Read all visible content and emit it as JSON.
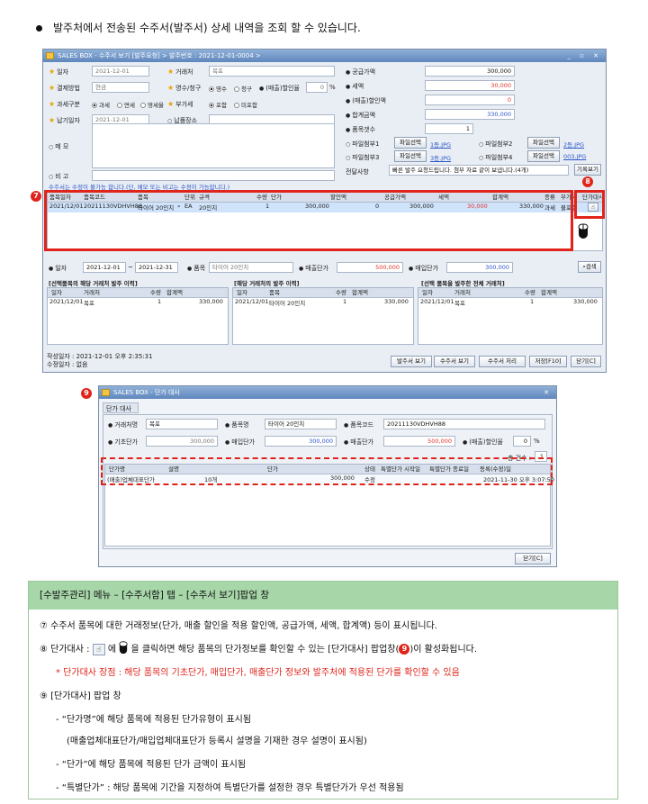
{
  "intro": "발주처에서 전송된 수주서(발주서) 상세 내역을 조회 할 수 있습니다.",
  "window1": {
    "title": "SALES BOX - 수주서 보기 [발주요청] > 발주번호 : 2021-12-01-0004 >",
    "form": {
      "date_label": "일자",
      "date_value": "2021-12-01",
      "partner_label": "거래처",
      "partner_value": "목포",
      "pay_label": "결제방법",
      "pay_value": "현금",
      "receipt_label": "영수/청구",
      "receipt_opt1": "영수",
      "receipt_opt2": "청구",
      "discount_rate_label": "(매출)할인율",
      "discount_rate_value": "0",
      "discount_rate_unit": "%",
      "tax_label": "과세구분",
      "tax_opt1": "과세",
      "tax_opt2": "면세",
      "tax_opt3": "영세율",
      "vat_label": "부가세",
      "vat_opt1": "포함",
      "vat_opt2": "미포함",
      "delivery_label": "납기일자",
      "delivery_value": "2021-12-01",
      "place_label": "납품장소",
      "memo_label": "메 모",
      "remark_label": "비 고"
    },
    "totals": {
      "supply_label": "공급가액",
      "supply_value": "300,000",
      "tax_label": "세액",
      "tax_value": "30,000",
      "disc_label": "(매출)할인액",
      "disc_value": "0",
      "sum_label": "합계금액",
      "sum_value": "330,000",
      "count_label": "품목갯수",
      "count_value": "1",
      "file1_label": "파일첨부1",
      "file1_btn": "파일선택",
      "file1_link": "1등.JPG",
      "file2_label": "파일첨부2",
      "file2_btn": "파일선택",
      "file2_link": "2등.JPG",
      "file3_label": "파일첨부3",
      "file3_btn": "파일선택",
      "file3_link": "3등.JPG",
      "file4_label": "파일첨부4",
      "file4_btn": "파일선택",
      "file4_link": "003.JPG",
      "msg_label": "전달사항",
      "msg_value": "빠른 발주 요청드립니다. 첨부 자료 같이 보냅니다.(4개)",
      "detail_btn": "기록보기"
    },
    "notice": "수주서는 수정이 불가능 합니다.(단, 메모 또는 비고는 수정이 가능합니다.)",
    "grid": {
      "headers": [
        "품목일자",
        "품목코드",
        "품목",
        "단위",
        "규격",
        "수량",
        "단가",
        "할인액",
        "공급가액",
        "세액",
        "합계액",
        "종류",
        "부가세",
        "단가대사"
      ],
      "row": [
        "2021/12/01",
        "20211130VDHVH88",
        "타이어 20인치",
        "EA",
        "20인치",
        "1",
        "300,000",
        "0",
        "300,000",
        "30,000",
        "330,000",
        "과세",
        "불포함"
      ]
    },
    "search": {
      "date_label": "일자",
      "from": "2021-12-01",
      "tilde": "~",
      "to": "2021-12-31",
      "item_label": "품목",
      "item_value": "타이어 20인치",
      "sale_label": "매출단가",
      "sale_value": "500,000",
      "buy_label": "매입단가",
      "buy_value": "300,000",
      "search_btn": "검색"
    },
    "panels": [
      {
        "title": "[선택품목의 해당 거래처 발주 이력]",
        "headers": [
          "일자",
          "거래처",
          "수량",
          "합계액"
        ],
        "row": [
          "2021/12/01",
          "목포",
          "1",
          "330,000"
        ]
      },
      {
        "title": "[해당 거래처의 발주 이력]",
        "headers": [
          "일자",
          "품목",
          "수량",
          "합계액"
        ],
        "row": [
          "2021/12/01",
          "타이어 20인치",
          "1",
          "330,000"
        ]
      },
      {
        "title": "[선택 품목을 발주한 전체 거래처]",
        "headers": [
          "일자",
          "거래처",
          "수량",
          "합계액"
        ],
        "row": [
          "2021/12/01",
          "목포",
          "1",
          "330,000"
        ]
      }
    ],
    "footer": {
      "created": "작성일자 : 2021-12-01 오후 2:35:31",
      "modified": "수정일자 : 없음",
      "btn1": "발주서 보기",
      "btn2": "수주서 보기",
      "btn3": "수주서 처리",
      "btn4": "저장[F10]",
      "btn5": "닫기[C]"
    }
  },
  "badges": {
    "b7": "7",
    "b8": "8",
    "b9": "9"
  },
  "window2": {
    "title": "SALES BOX - 단가 대사",
    "tab": "단가 대사",
    "partner_label": "거래처명",
    "partner_value": "목포",
    "item_label": "품목명",
    "item_value": "타이어 20인치",
    "code_label": "품목코드",
    "code_value": "20211130VDHVH88",
    "base_label": "기초단가",
    "base_value": "300,000",
    "buy_label": "매입단가",
    "buy_value": "300,000",
    "sale_label": "매출단가",
    "sale_value": "500,000",
    "disc_label": "(매출)할인율",
    "disc_value": "0",
    "disc_unit": "%",
    "count_label": "총 건수 :",
    "count_value": "1",
    "headers": [
      "단가명",
      "설명",
      "단가",
      "상태",
      "특별단가 시작일",
      "특별단가 종료일",
      "등록(수정)일"
    ],
    "row": [
      "(매출)업체대표단가",
      "10개",
      "300,000",
      "수정",
      "",
      "",
      "2021-11-30 오후 3:07:50"
    ],
    "close_btn": "닫기[C]"
  },
  "explain": {
    "header": "[수발주관리] 메뉴 – [수주서함] 탭 – [수주서 보기]팝업 창",
    "l7": "⑦  수주서 품목에 대한 거래정보(단가, 매출 할인을 적용 할인액, 공급가액, 세액, 합계액) 등이 표시됩니다.",
    "l8a": "⑧  단가대사 :",
    "l8b": "에",
    "l8c": "을 클릭하면 해당 품목의 단가정보를 확인할 수 있는 [단가대사] 팝업창(",
    "l8d": ")이 활성화됩니다.",
    "l8num": "9",
    "lred": "* 단가대사 장점 : 해당 품목의 기초단가, 매입단가, 매출단가 정보와 발주처에 적용된 단가를 확인할 수 있음",
    "l9": "⑨  [단가대사] 팝업 창",
    "l9a": "- “단가명”에 해당 품목에 적용된 단가유형이 표시됨",
    "l9b": "(매출업체대표단가/매입업체대표단가 등록시 설명을 기재한 경우 설명이 표시됨)",
    "l9c": "- “단가”에 해당 품목에 적용된 단가 금액이 표시됨",
    "l9d": "- “특별단가” : 해당 품목에 기간을 지정하여 특별단가를 설정한 경우 특별단가가 우선 적용됨"
  }
}
